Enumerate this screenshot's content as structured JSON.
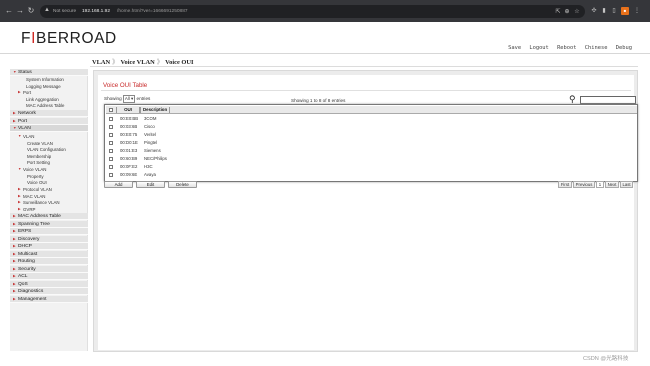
{
  "browser": {
    "security_label": "Not secure",
    "url_host": "192.168.1.92",
    "url_path": "/home.html?ver=1666691250887"
  },
  "header": {
    "logo_first": "F",
    "logo_mid": "I",
    "logo_rest": "BERROAD",
    "links": [
      "Save",
      "Logout",
      "Reboot",
      "Chinese",
      "Debug"
    ]
  },
  "breadcrumb": [
    "VLAN",
    "Voice VLAN",
    "Voice OUI"
  ],
  "breadcrumb_sep": "》",
  "sidebar": {
    "status": "Status",
    "status_items": [
      "System Information",
      "Logging Message"
    ],
    "port_sub": "Port",
    "port_sub_items": [
      "Link Aggregation",
      "MAC Address Table"
    ],
    "network": "Network",
    "port": "Port",
    "vlan": "VLAN",
    "vlan_sub": "VLAN",
    "vlan_sub_items": [
      "Create VLAN",
      "VLAN Configuration",
      "Membership",
      "Port Setting"
    ],
    "voice_vlan": "Voice VLAN",
    "voice_vlan_items": [
      "Property",
      "Voice OUI"
    ],
    "other_sub": [
      "Protocol VLAN",
      "MAC VLAN",
      "Surveillance VLAN",
      "GVRP"
    ],
    "mains": [
      "MAC Address Table",
      "Spanning Tree",
      "ERPS",
      "Discovery",
      "DHCP",
      "Multicast",
      "Routing",
      "Security",
      "ACL",
      "QoS",
      "Diagnostics",
      "Management"
    ]
  },
  "panel": {
    "title": "Voice OUI Table",
    "showing_prefix": "Showing",
    "showing_value": "All",
    "showing_suffix": "entries",
    "info": "Showing 1 to 8 of 8 entries"
  },
  "table": {
    "headers": [
      "OUI",
      "Description"
    ],
    "rows": [
      {
        "oui": "00:E0:BB",
        "desc": "3COM"
      },
      {
        "oui": "00:03:6B",
        "desc": "Cisco"
      },
      {
        "oui": "00:E0:75",
        "desc": "Veritel"
      },
      {
        "oui": "00:D0:1E",
        "desc": "Pingtel"
      },
      {
        "oui": "00:01:E3",
        "desc": "Siemens"
      },
      {
        "oui": "00:60:B9",
        "desc": "NEC/Philips"
      },
      {
        "oui": "00:0F:E2",
        "desc": "H3C"
      },
      {
        "oui": "00:09:6E",
        "desc": "Avaya"
      }
    ]
  },
  "actions": [
    "Add",
    "Edit",
    "Delete"
  ],
  "pagination": [
    "First",
    "Previous",
    "1",
    "Next",
    "Last"
  ],
  "watermark": "CSDN @光路科技",
  "colors": {
    "accent": "#d02b25",
    "chrome": "#35363a"
  },
  "icons": [
    "back-icon",
    "forward-icon",
    "reload-icon",
    "search-icon"
  ]
}
